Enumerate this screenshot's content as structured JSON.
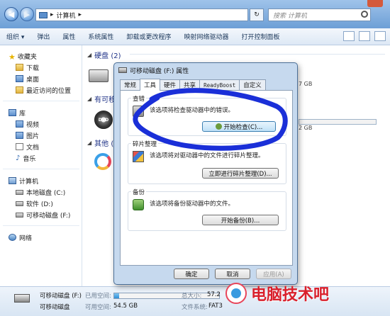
{
  "address": {
    "crumbs": [
      "▸",
      "计算机",
      "▸"
    ],
    "search_placeholder": "搜索 计算机"
  },
  "toolbar": {
    "items": [
      "组织 ▾",
      "弹出",
      "属性",
      "系统属性",
      "卸载或更改程序",
      "映射网络驱动器",
      "打开控制面板"
    ]
  },
  "sidebar": {
    "favorites": "收藏夹",
    "fav_items": [
      "下载",
      "桌面",
      "最近访问的位置"
    ],
    "libraries": "库",
    "lib_items": [
      "视频",
      "图片",
      "文档",
      "音乐"
    ],
    "computer": "计算机",
    "pc_items": [
      "本地磁盘 (C:)",
      "软件 (D:)",
      "可移动磁盘 (F:)"
    ],
    "network": "网络"
  },
  "content": {
    "group_hdd": "硬盘 (2)",
    "group_removable": "有可移",
    "group_other": "其他 (",
    "size_text_1": "7 GB",
    "size_text_2": "2 GB",
    "dvd_label": "DVD"
  },
  "status": {
    "name": "可移动磁盘 (F:)",
    "type": "可移动磁盘",
    "used_label": "已用空间:",
    "free_label": "可用空间:",
    "free_value": "54.5 GB",
    "total_label": "总大小:",
    "total_value": "57.2",
    "fs_label": "文件系统:",
    "fs_value": "FAT3",
    "used_fraction": 0.05
  },
  "dialog": {
    "title": "可移动磁盘 (F:) 属性",
    "tabs": [
      "常规",
      "工具",
      "硬件",
      "共享",
      "ReadyBoost",
      "自定义"
    ],
    "active_tab": "工具",
    "check": {
      "title": "查错",
      "text": "该选项将检查驱动器中的错误。",
      "button": "开始检查(C)..."
    },
    "defrag": {
      "title": "碎片整理",
      "text": "该选项将对驱动器中的文件进行碎片整理。",
      "button": "立即进行碎片整理(D)..."
    },
    "backup": {
      "title": "备份",
      "text": "该选项将备份驱动器中的文件。",
      "button": "开始备份(B)..."
    },
    "ok": "确定",
    "cancel": "取消",
    "apply": "应用(A)"
  },
  "watermark": {
    "text": "电脑技术吧"
  },
  "colors": {
    "annotation": "#1a2fd8",
    "watermark": "#d9202c"
  }
}
